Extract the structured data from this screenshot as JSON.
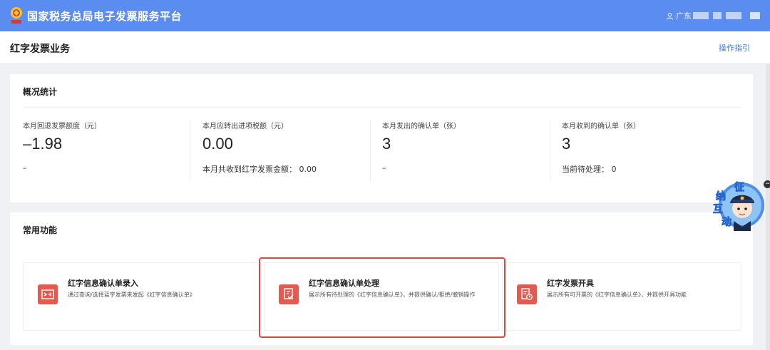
{
  "header": {
    "app_title": "国家税务总局电子发票服务平台",
    "user_label": "广东",
    "logo_icon": "tax-emblem-icon",
    "user_icon": "user-icon"
  },
  "subheader": {
    "page_title": "红字发票业务",
    "guide_label": "操作指引"
  },
  "overview": {
    "title": "概况统计",
    "stats": [
      {
        "label": "本月回退发票额度（元）",
        "value": "–1.98",
        "sub": "–"
      },
      {
        "label": "本月应转出进项税额（元）",
        "value": "0.00",
        "sub": "本月共收到红字发票金额：  0.00"
      },
      {
        "label": "本月发出的确认单（张）",
        "value": "3",
        "sub": "–"
      },
      {
        "label": "本月收到的确认单（张）",
        "value": "3",
        "sub": "当前待处理：  0"
      }
    ]
  },
  "functions": {
    "title": "常用功能",
    "items": [
      {
        "name": "红字信息确认单录入",
        "desc": "通过查询/选择蓝字发票来发起《红字信息确认单》",
        "icon": "exchange-icon"
      },
      {
        "name": "红字信息确认单处理",
        "desc": "展示所有待处理的《红字信息确认单》，并提供确认/拒绝/撤销操作",
        "icon": "document-check-icon"
      },
      {
        "name": "红字发票开具",
        "desc": "展示所有可开票的《红字信息确认单》，并提供开具功能",
        "icon": "invoice-clock-icon"
      }
    ],
    "highlighted_index": 1
  },
  "assistant": {
    "chars": [
      "征",
      "纳",
      "互",
      "动"
    ],
    "close_glyph": "−"
  },
  "colors": {
    "topbar": "#5b8cf0",
    "accent_red": "#e5594f",
    "link_blue": "#3b78e7",
    "highlight_border": "#e0463a"
  }
}
